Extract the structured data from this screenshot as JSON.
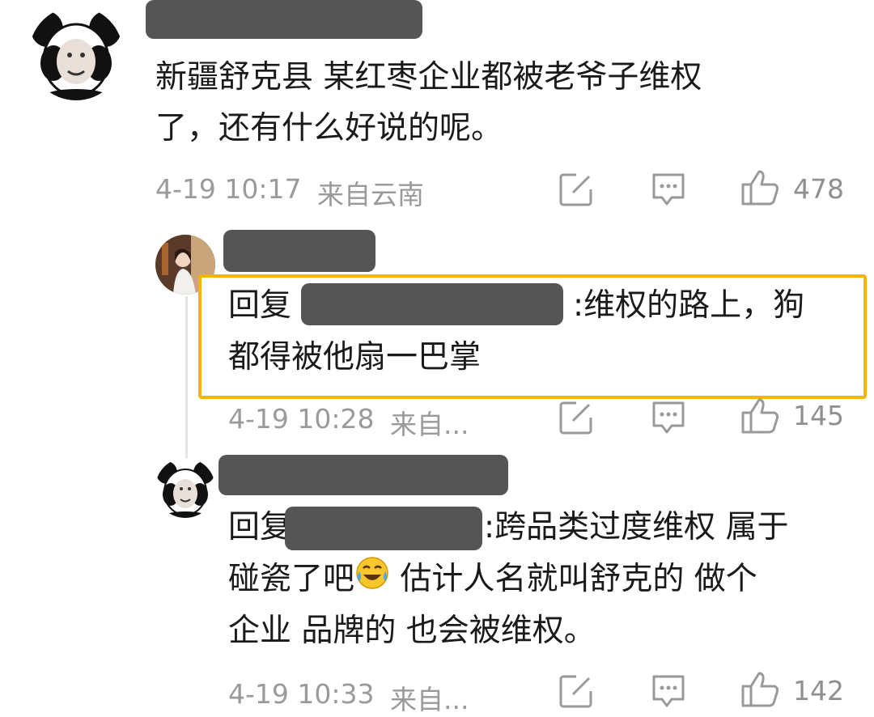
{
  "comments": [
    {
      "text_lines": [
        "新疆舒克县 某红枣企业都被老爷子维权",
        "了，还有什么好说的呢。"
      ],
      "time": "4-19 10:17",
      "location": "来自云南",
      "likes": "478"
    },
    {
      "reply_prefix": "回复",
      "text_line1": ":维权的路上，狗",
      "text_line2": "都得被他扇一巴掌",
      "time": "4-19 10:28",
      "location": "来自...",
      "likes": "145"
    },
    {
      "reply_prefix": "回复",
      "text_line1": ":跨品类过度维权 属于",
      "text_line2a": "碰瓷了吧",
      "text_line2b": " 估计人名就叫舒克的 做个",
      "text_line3": "企业 品牌的 也会被维权。",
      "time": "4-19 10:33",
      "location": "来自...",
      "likes": "142"
    }
  ],
  "icons": {
    "share": "share-edit-icon",
    "comment": "comment-icon",
    "like": "thumbs-up-icon",
    "emoji": "laughing-crying-emoji"
  },
  "colors": {
    "highlight_border": "#f7b500",
    "redaction": "#555555",
    "meta_text": "#9a9a9a"
  }
}
